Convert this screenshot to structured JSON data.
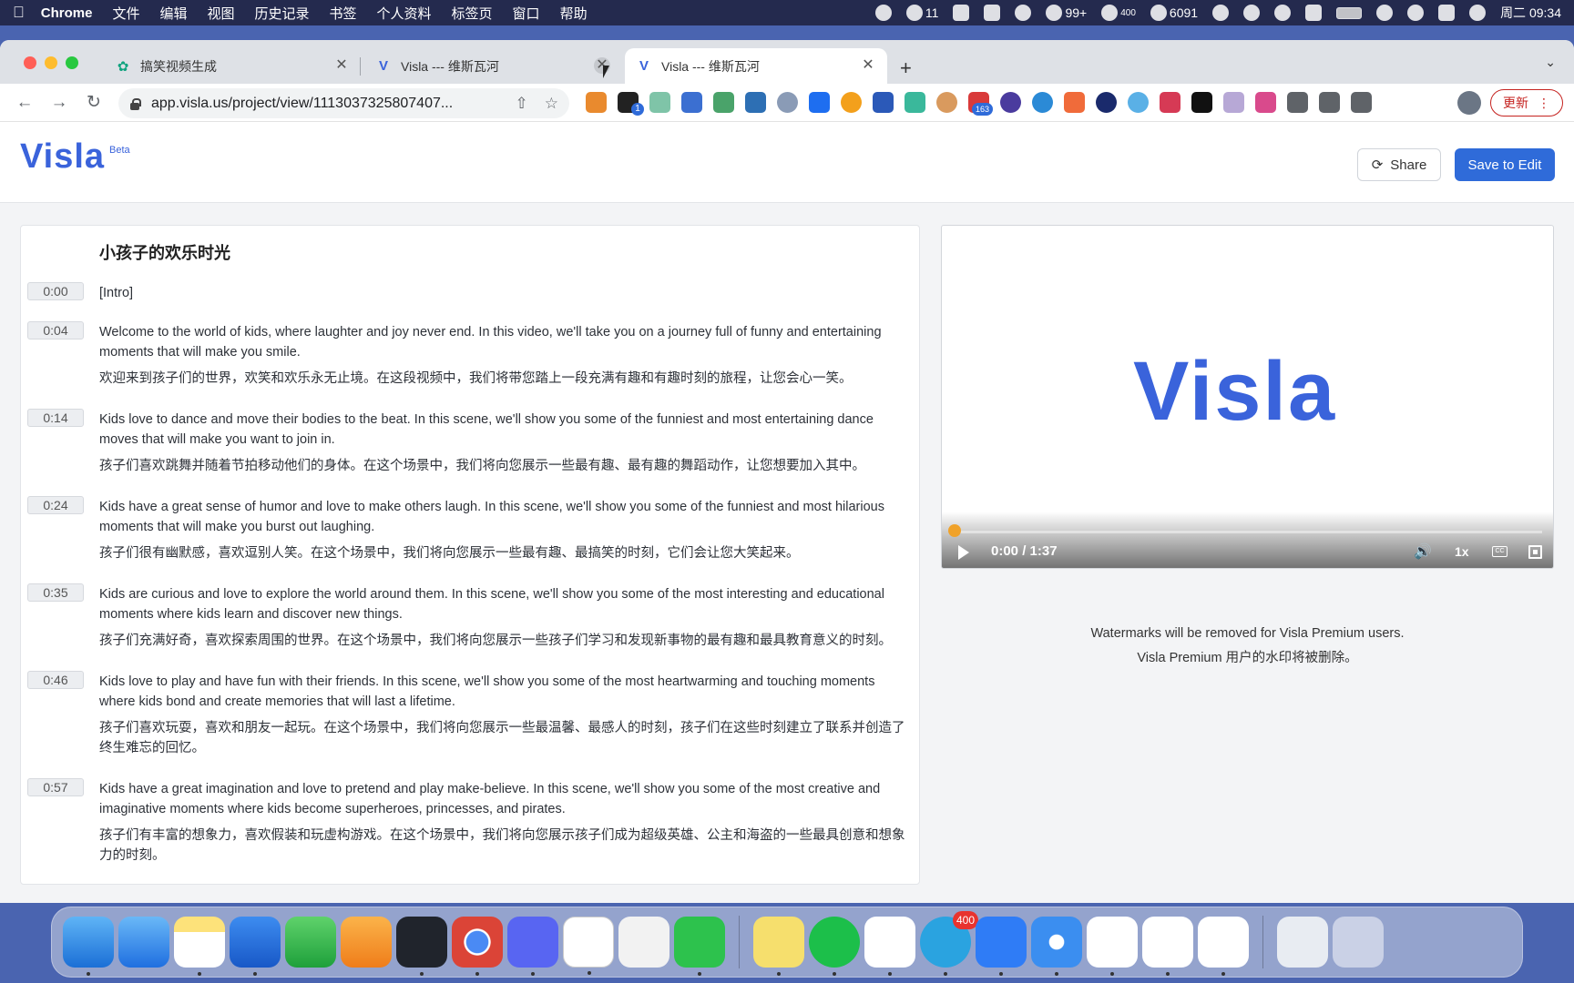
{
  "menubar": {
    "app_name": "Chrome",
    "menus": [
      "文件",
      "编辑",
      "视图",
      "历史记录",
      "书签",
      "个人资料",
      "标签页",
      "窗口",
      "帮助"
    ],
    "status": {
      "chat_count": "11",
      "wechat_count": "99+",
      "badge_400": "400",
      "weibo_count": "6091",
      "datetime": "周二 09:34"
    }
  },
  "tabs": [
    {
      "title": "搞笑视频生成",
      "icon": "openai-icon"
    },
    {
      "title": "Visla --- 维斯瓦河",
      "icon": "visla-icon"
    },
    {
      "title": "Visla --- 维斯瓦河",
      "icon": "visla-icon",
      "active": true
    }
  ],
  "address_bar": {
    "url": "app.visla.us/project/view/1113037325807407..."
  },
  "toolbar": {
    "extension_badge_1": "1",
    "extension_badge_163": "163",
    "update_label": "更新"
  },
  "app": {
    "logo": "Visla",
    "beta": "Beta",
    "share_label": "Share",
    "save_label": "Save to Edit"
  },
  "script": {
    "title": "小孩子的欢乐时光",
    "segments": [
      {
        "time": "0:00",
        "en": "[Intro]",
        "zh": ""
      },
      {
        "time": "0:04",
        "en": "Welcome to the world of kids, where laughter and joy never end. In this video, we'll take you on a journey full of funny and entertaining moments that will make you smile.",
        "zh": "欢迎来到孩子们的世界，欢笑和欢乐永无止境。在这段视频中，我们将带您踏上一段充满有趣和有趣时刻的旅程，让您会心一笑。"
      },
      {
        "time": "0:14",
        "en": "Kids love to dance and move their bodies to the beat. In this scene, we'll show you some of the funniest and most entertaining dance moves that will make you want to join in.",
        "zh": "孩子们喜欢跳舞并随着节拍移动他们的身体。在这个场景中，我们将向您展示一些最有趣、最有趣的舞蹈动作，让您想要加入其中。"
      },
      {
        "time": "0:24",
        "en": "Kids have a great sense of humor and love to make others laugh. In this scene, we'll show you some of the funniest and most hilarious moments that will make you burst out laughing.",
        "zh": "孩子们很有幽默感，喜欢逗别人笑。在这个场景中，我们将向您展示一些最有趣、最搞笑的时刻，它们会让您大笑起来。"
      },
      {
        "time": "0:35",
        "en": "Kids are curious and love to explore the world around them. In this scene, we'll show you some of the most interesting and educational moments where kids learn and discover new things.",
        "zh": "孩子们充满好奇，喜欢探索周围的世界。在这个场景中，我们将向您展示一些孩子们学习和发现新事物的最有趣和最具教育意义的时刻。"
      },
      {
        "time": "0:46",
        "en": "Kids love to play and have fun with their friends. In this scene, we'll show you some of the most heartwarming and touching moments where kids bond and create memories that will last a lifetime.",
        "zh": "孩子们喜欢玩耍，喜欢和朋友一起玩。在这个场景中，我们将向您展示一些最温馨、最感人的时刻，孩子们在这些时刻建立了联系并创造了终生难忘的回忆。"
      },
      {
        "time": "0:57",
        "en": "Kids have a great imagination and love to pretend and play make-believe. In this scene, we'll show you some of the most creative and imaginative moments where kids become superheroes, princesses, and pirates.",
        "zh": "孩子们有丰富的想象力，喜欢假装和玩虚构游戏。在这个场景中，我们将向您展示孩子们成为超级英雄、公主和海盗的一些最具创意和想象力的时刻。"
      }
    ]
  },
  "player": {
    "logo": "Visla",
    "time": "0:00 / 1:37",
    "progress": 0.0,
    "speed": "1x",
    "cc": "CC",
    "accent": "#f0a22a"
  },
  "watermark_note": {
    "en": "Watermarks will be removed for Visla Premium users.",
    "zh": "Visla Premium 用户的水印将被删除。"
  },
  "dock": {
    "telegram_badge": "400",
    "apps": [
      "finder-icon",
      "mail-icon",
      "notes-icon",
      "keynote-icon",
      "numbers-icon",
      "pages-icon",
      "quicktime-icon",
      "chrome-icon",
      "discord-icon",
      "notion-icon",
      "app-red-icon",
      "wechat-icon",
      "stickies-icon",
      "app-green-icon",
      "app-blue-icon",
      "telegram-icon",
      "feishu-icon",
      "safari-icon",
      "messages-icon",
      "wps-icon",
      "vscode-icon",
      "document-icon",
      "trash-icon"
    ]
  },
  "colors": {
    "brand": "#3a63db",
    "primary_button": "#2f6bd9",
    "update": "#c5221f"
  }
}
